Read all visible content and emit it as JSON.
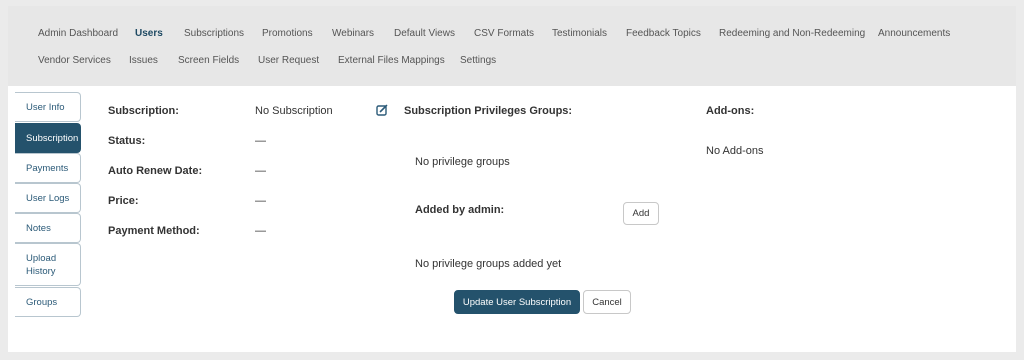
{
  "nav": {
    "items": [
      "Admin Dashboard",
      "Users",
      "Subscriptions",
      "Promotions",
      "Webinars",
      "Default Views",
      "CSV Formats",
      "Testimonials",
      "Feedback Topics",
      "Redeeming and Non-Redeeming",
      "Announcements",
      "Vendor Services",
      "Issues",
      "Screen Fields",
      "User Request",
      "External Files Mappings",
      "Settings"
    ],
    "active": "Users"
  },
  "sidebar": {
    "tabs": [
      "User Info",
      "Subscription",
      "Payments",
      "User Logs",
      "Notes",
      "Upload History",
      "Groups"
    ],
    "active": "Subscription"
  },
  "subscription": {
    "subscription_label": "Subscription:",
    "subscription_value": "No Subscription",
    "status_label": "Status:",
    "status_value": "—",
    "auto_renew_label": "Auto Renew Date:",
    "auto_renew_value": "—",
    "price_label": "Price:",
    "price_value": "—",
    "payment_method_label": "Payment Method:",
    "payment_method_value": "—"
  },
  "privileges": {
    "heading": "Subscription Privileges Groups:",
    "empty_text": "No privilege groups",
    "added_by_admin_label": "Added by admin:",
    "add_button": "Add",
    "added_empty_text": "No privilege groups added yet"
  },
  "addons": {
    "heading": "Add-ons:",
    "empty_text": "No Add-ons"
  },
  "actions": {
    "update_button": "Update User Subscription",
    "cancel_button": "Cancel"
  },
  "icons": {
    "edit": "edit-square-icon"
  },
  "colors": {
    "accent": "#24526c",
    "nav_active": "#1f4a63",
    "page_bg": "#ebebeb",
    "nav_bg": "#e7e7e7"
  }
}
